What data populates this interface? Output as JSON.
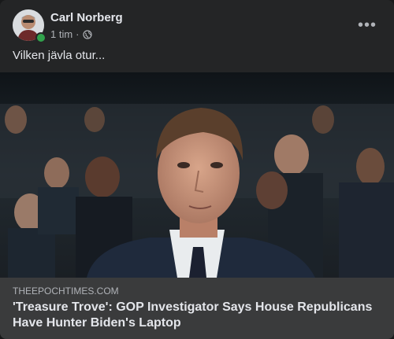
{
  "post": {
    "author": "Carl Norberg",
    "time": "1 tim",
    "separator": "·",
    "text": "Vilken jävla otur...",
    "more_icon": "more-horizontal-icon",
    "privacy_icon": "globe-icon"
  },
  "link": {
    "domain": "THEEPOCHTIMES.COM",
    "title": "'Treasure Trove': GOP Investigator Says House Republicans Have Hunter Biden's Laptop"
  },
  "colors": {
    "card": "#242526",
    "link_bar": "#3a3b3c",
    "online": "#31a24c",
    "text_primary": "#e4e6eb",
    "text_secondary": "#b0b3b8"
  }
}
